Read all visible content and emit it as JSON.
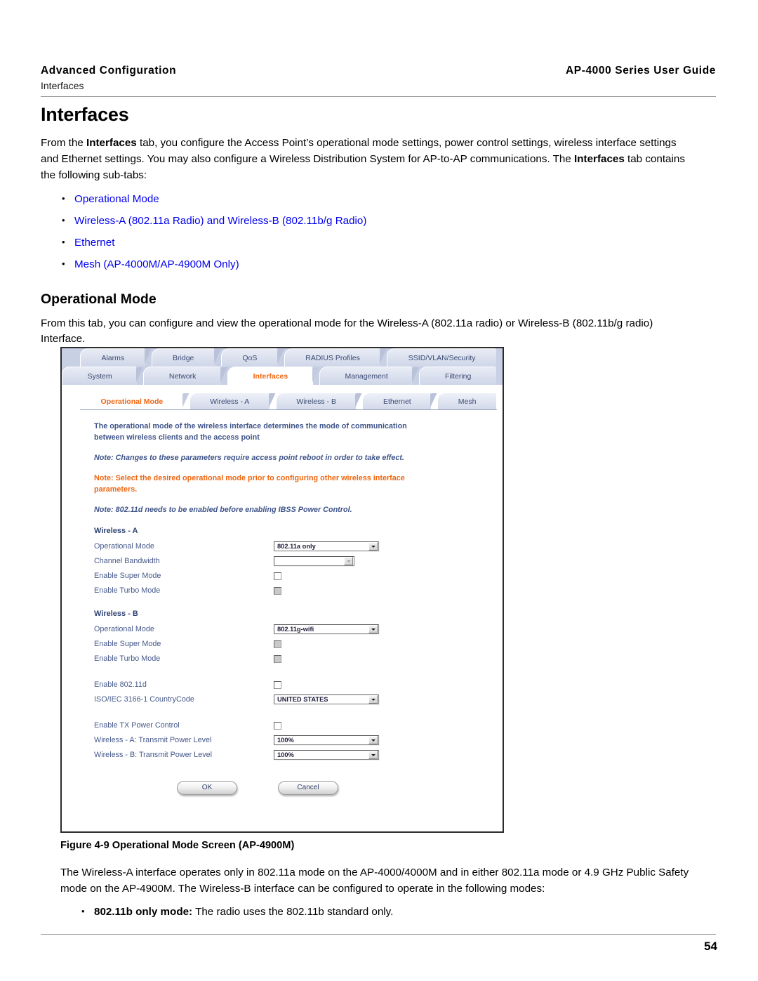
{
  "header": {
    "left_title": "Advanced Configuration",
    "left_sub": "Interfaces",
    "right_title": "AP-4000 Series User Guide"
  },
  "page_title": "Interfaces",
  "intro": {
    "line1_a": "From the ",
    "line1_b": "Interfaces",
    "line1_c": " tab, you configure the Access Point’s operational mode settings, power control settings, wireless interface settings and Ethernet settings. You may also configure a Wireless Distribution System for AP-to-AP communications. The ",
    "line1_d": "Interfaces",
    "line1_e": " tab contains the following sub-tabs:"
  },
  "sub_tab_links": [
    "Operational Mode",
    "Wireless-A (802.11a Radio) and Wireless-B (802.11b/g Radio)",
    "Ethernet",
    "Mesh (AP-4000M/AP-4900M Only)"
  ],
  "section": {
    "heading": "Operational Mode",
    "paragraph": "From this tab, you can configure and view the operational mode for the Wireless-A (802.11a radio) or Wireless-B (802.11b/g radio) Interface."
  },
  "screenshot": {
    "top_tabs": [
      "Alarms",
      "Bridge",
      "QoS",
      "RADIUS Profiles",
      "SSID/VLAN/Security"
    ],
    "main_tabs": [
      "System",
      "Network",
      "Interfaces",
      "Management",
      "Filtering"
    ],
    "main_tab_active": "Interfaces",
    "sub_tabs": [
      "Operational Mode",
      "Wireless - A",
      "Wireless - B",
      "Ethernet",
      "Mesh"
    ],
    "sub_tab_active": "Operational Mode",
    "description": "The operational mode of the wireless interface determines the mode of communication between wireless clients and the access point",
    "note1": "Note: Changes to these parameters require access point reboot in order to take effect.",
    "note2": "Note: Select the desired operational mode prior to configuring other wireless interface parameters.",
    "note3": "Note: 802.11d needs to be enabled before enabling IBSS Power Control.",
    "wireless_a": {
      "title": "Wireless - A",
      "rows": [
        {
          "label": "Operational Mode",
          "value": "802.11a only"
        },
        {
          "label": "Channel Bandwidth",
          "value": ""
        },
        {
          "label": "Enable Super Mode",
          "value": ""
        },
        {
          "label": "Enable Turbo Mode",
          "value": ""
        }
      ]
    },
    "wireless_b": {
      "title": "Wireless - B",
      "rows": [
        {
          "label": "Operational Mode",
          "value": "802.11g-wifi"
        },
        {
          "label": "Enable Super Mode",
          "value": ""
        },
        {
          "label": "Enable Turbo Mode",
          "value": ""
        }
      ]
    },
    "country": {
      "enable_label": "Enable 802.11d",
      "code_label": "ISO/IEC 3166-1 CountryCode",
      "code_value": "UNITED STATES"
    },
    "power": {
      "enable_label": "Enable TX Power Control",
      "a_label": "Wireless - A: Transmit Power Level",
      "a_value": "100%",
      "b_label": "Wireless - B: Transmit Power Level",
      "b_value": "100%"
    },
    "buttons": {
      "ok": "OK",
      "cancel": "Cancel"
    }
  },
  "caption": "Figure 4-9 Operational Mode Screen (AP-4900M)",
  "tail": {
    "paragraph": "The Wireless-A interface operates only in 802.11a mode on the AP-4000/4000M and in either 802.11a mode or 4.9 GHz Public Safety mode on the AP-4900M. The Wireless-B interface can be configured to operate in the following modes:",
    "bullet_bold": "802.11b only mode:",
    "bullet_rest": " The radio uses the 802.11b standard only."
  },
  "page_number": "54",
  "colors": {
    "link": "#0000ee",
    "accent_orange": "#ee6611",
    "panel_blue": "#45598c",
    "tab_bg": "#c8d0e4"
  }
}
